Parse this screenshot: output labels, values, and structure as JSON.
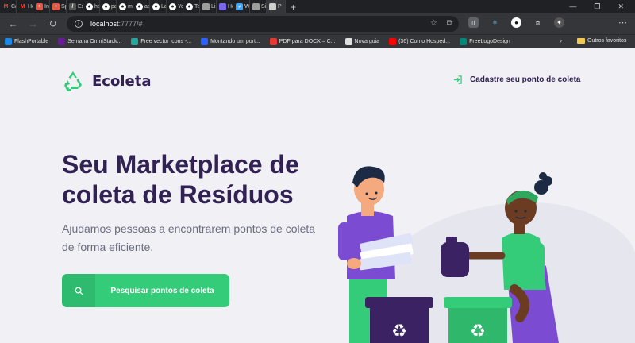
{
  "browser": {
    "tabs": [
      {
        "label": "Caixa",
        "favicon": "gmail-icon",
        "color": "#ea4335",
        "glyph": "M"
      },
      {
        "label": "Hosti",
        "favicon": "gmail-icon",
        "color": "#ea4335",
        "glyph": "M"
      },
      {
        "label": "Inscr",
        "favicon": "rocket-icon",
        "color": "#e05a47",
        "glyph": "•"
      },
      {
        "label": "Speal",
        "favicon": "rocket-icon",
        "color": "#e05a47",
        "glyph": "•"
      },
      {
        "label": "Exper",
        "favicon": "pen-icon",
        "color": "#555555",
        "glyph": "/"
      },
      {
        "label": "hstra",
        "favicon": "github-icon",
        "color": "#ffffff",
        "glyph": ""
      },
      {
        "label": "patric",
        "favicon": "github-icon",
        "color": "#ffffff",
        "glyph": ""
      },
      {
        "label": "marc",
        "favicon": "github-icon",
        "color": "#ffffff",
        "glyph": ""
      },
      {
        "label": "askm",
        "favicon": "github-icon",
        "color": "#ffffff",
        "glyph": ""
      },
      {
        "label": "Laura",
        "favicon": "github-icon",
        "color": "#ffffff",
        "glyph": ""
      },
      {
        "label": "Your",
        "favicon": "github-icon",
        "color": "#ffffff",
        "glyph": ""
      },
      {
        "label": "Tailw",
        "favicon": "github-icon",
        "color": "#ffffff",
        "glyph": ""
      },
      {
        "label": "Listar",
        "favicon": "page-icon",
        "color": "#9e9e9e",
        "glyph": ""
      },
      {
        "label": "Hello",
        "favicon": "circle-icon",
        "color": "#7b68ee",
        "glyph": ""
      },
      {
        "label": "Wind",
        "favicon": "flutter-icon",
        "color": "#42a5f5",
        "glyph": "⚡"
      },
      {
        "label": "Signu",
        "favicon": "page-icon",
        "color": "#9e9e9e",
        "glyph": ""
      },
      {
        "label": "P",
        "favicon": "page-icon",
        "color": "#cfcfcf",
        "glyph": "",
        "active": true
      }
    ],
    "url_host": "localhost",
    "url_path": ":7777/#",
    "bookmarks": [
      {
        "label": "FlashPortable",
        "color": "#1e88e5"
      },
      {
        "label": "Semana OmniStack...",
        "color": "#6a1b9a"
      },
      {
        "label": "Free vector icons -...",
        "color": "#26a69a"
      },
      {
        "label": "Montando um port...",
        "color": "#2962ff"
      },
      {
        "label": "PDF para DOCX – C...",
        "color": "#e53935"
      },
      {
        "label": "Nova guia",
        "color": "#e0e0e0"
      },
      {
        "label": "(36) Como Hosped...",
        "color": "#ff0000"
      },
      {
        "label": "FreeLogoDesign",
        "color": "#00897b"
      }
    ],
    "bookmarks_other": "Outros favoritos"
  },
  "header": {
    "logo_text": "Ecoleta",
    "register_label": "Cadastre seu ponto de coleta"
  },
  "hero": {
    "title": "Seu Marketplace de coleta de Resíduos",
    "description": "Ajudamos pessoas a encontrarem pontos de coleta de forma eficiente.",
    "search_label": "Pesquisar pontos de coleta"
  },
  "colors": {
    "brand_green": "#34cb79",
    "title_purple": "#322153",
    "text_gray": "#6c6c80",
    "background": "#f0f0f5"
  }
}
